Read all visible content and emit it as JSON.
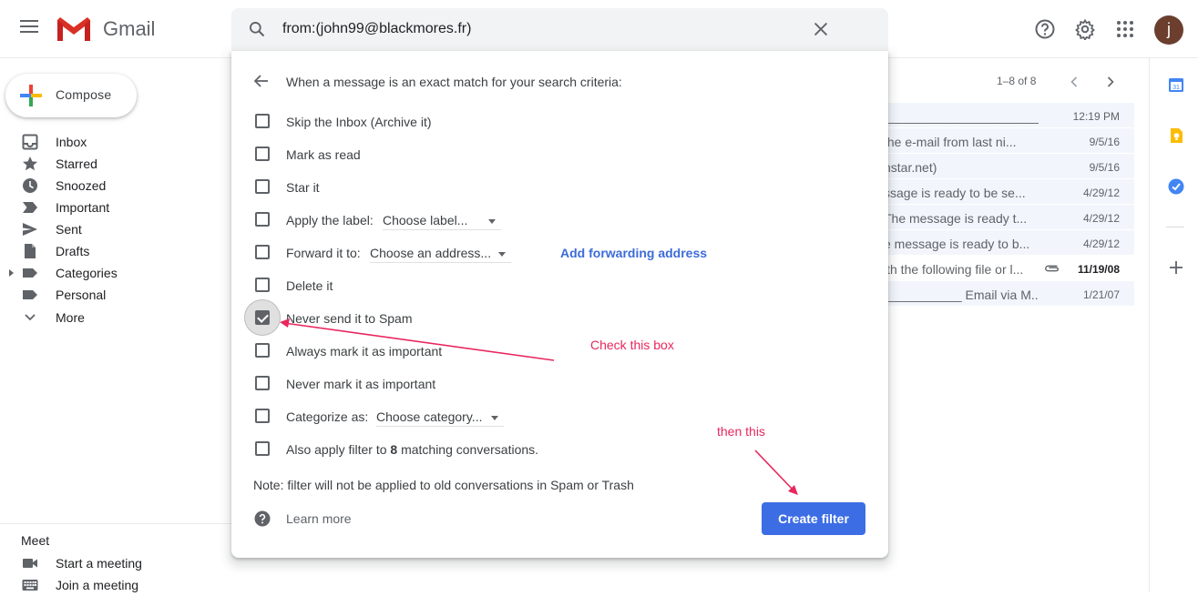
{
  "header": {
    "app_name": "Gmail",
    "search_query": "from:(john99@blackmores.fr)",
    "avatar_initial": "j"
  },
  "compose": {
    "label": "Compose"
  },
  "sidebar": {
    "items": [
      {
        "label": "Inbox",
        "icon": "inbox-icon"
      },
      {
        "label": "Starred",
        "icon": "star-icon"
      },
      {
        "label": "Snoozed",
        "icon": "clock-icon"
      },
      {
        "label": "Important",
        "icon": "important-icon"
      },
      {
        "label": "Sent",
        "icon": "send-icon"
      },
      {
        "label": "Drafts",
        "icon": "draft-icon"
      },
      {
        "label": "Categories",
        "icon": "label-icon"
      },
      {
        "label": "Personal",
        "icon": "label-icon"
      },
      {
        "label": "More",
        "icon": "chevron-down-icon"
      }
    ]
  },
  "meet": {
    "title": "Meet",
    "items": [
      {
        "label": "Start a meeting",
        "icon": "video-icon"
      },
      {
        "label": "Join a meeting",
        "icon": "keyboard-icon"
      }
    ]
  },
  "list": {
    "pager": "1–8 of 8",
    "rows": [
      {
        "snippet": "______________________...",
        "date": "12:19 PM",
        "unread": false
      },
      {
        "snippet": " the e-mail from last ni...",
        "date": "9/5/16",
        "unread": false
      },
      {
        "snippet": "nstar.net)",
        "date": "9/5/16",
        "unread": false
      },
      {
        "snippet": "ssage is ready to be se...",
        "date": "4/29/12",
        "unread": false
      },
      {
        "snippet": "The message is ready t...",
        "date": "4/29/12",
        "unread": false
      },
      {
        "snippet": "e message is ready to b...",
        "date": "4/29/12",
        "unread": false
      },
      {
        "snippet": "ith the following file or l...",
        "date": "11/19/08",
        "unread": true
      },
      {
        "snippet": "___________ Email via M...",
        "date": "1/21/07",
        "unread": false
      }
    ]
  },
  "dialog": {
    "title": "When a message is an exact match for your search criteria:",
    "options": {
      "skip_inbox": "Skip the Inbox (Archive it)",
      "mark_read": "Mark as read",
      "star": "Star it",
      "apply_label": "Apply the label:",
      "apply_label_dd": "Choose label...",
      "forward": "Forward it to:",
      "forward_dd": "Choose an address...",
      "forward_link": "Add forwarding address",
      "delete": "Delete it",
      "never_spam": "Never send it to Spam",
      "always_important": "Always mark it as important",
      "never_important": "Never mark it as important",
      "categorize": "Categorize as:",
      "categorize_dd": "Choose category...",
      "also_apply_prefix": "Also apply filter to ",
      "also_apply_count": "8",
      "also_apply_suffix": " matching conversations."
    },
    "checked": {
      "never_spam": true
    },
    "note": "Note: filter will not be applied to old conversations in Spam or Trash",
    "learn_more": "Learn more",
    "create_button": "Create filter"
  },
  "annotations": {
    "check_box": "Check this box",
    "then_this": "then this",
    "color": "#e8275d"
  },
  "colors": {
    "primary_button": "#3c6de4",
    "link": "#3c6cd8"
  }
}
